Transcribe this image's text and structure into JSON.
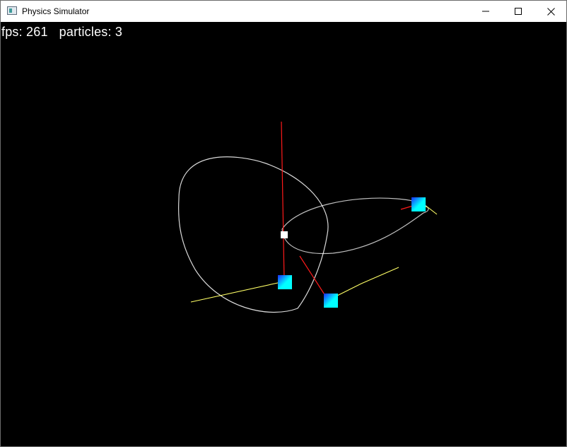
{
  "window": {
    "title": "Physics Simulator",
    "controls": {
      "minimize_icon": "minimize-icon",
      "maximize_icon": "maximize-icon",
      "close_icon": "close-icon"
    }
  },
  "hud": {
    "fps_label": "fps:",
    "fps_value": "261",
    "particles_label": "particles:",
    "particles_value": "3"
  },
  "scene": {
    "background": "#000000",
    "orbit_color": "#ffffff",
    "velocity_color": "#ff0000",
    "trail_color": "#ffff66",
    "particle_gradient": [
      "#1a2cff",
      "#00ffff"
    ],
    "center_color": "#ffffff"
  }
}
